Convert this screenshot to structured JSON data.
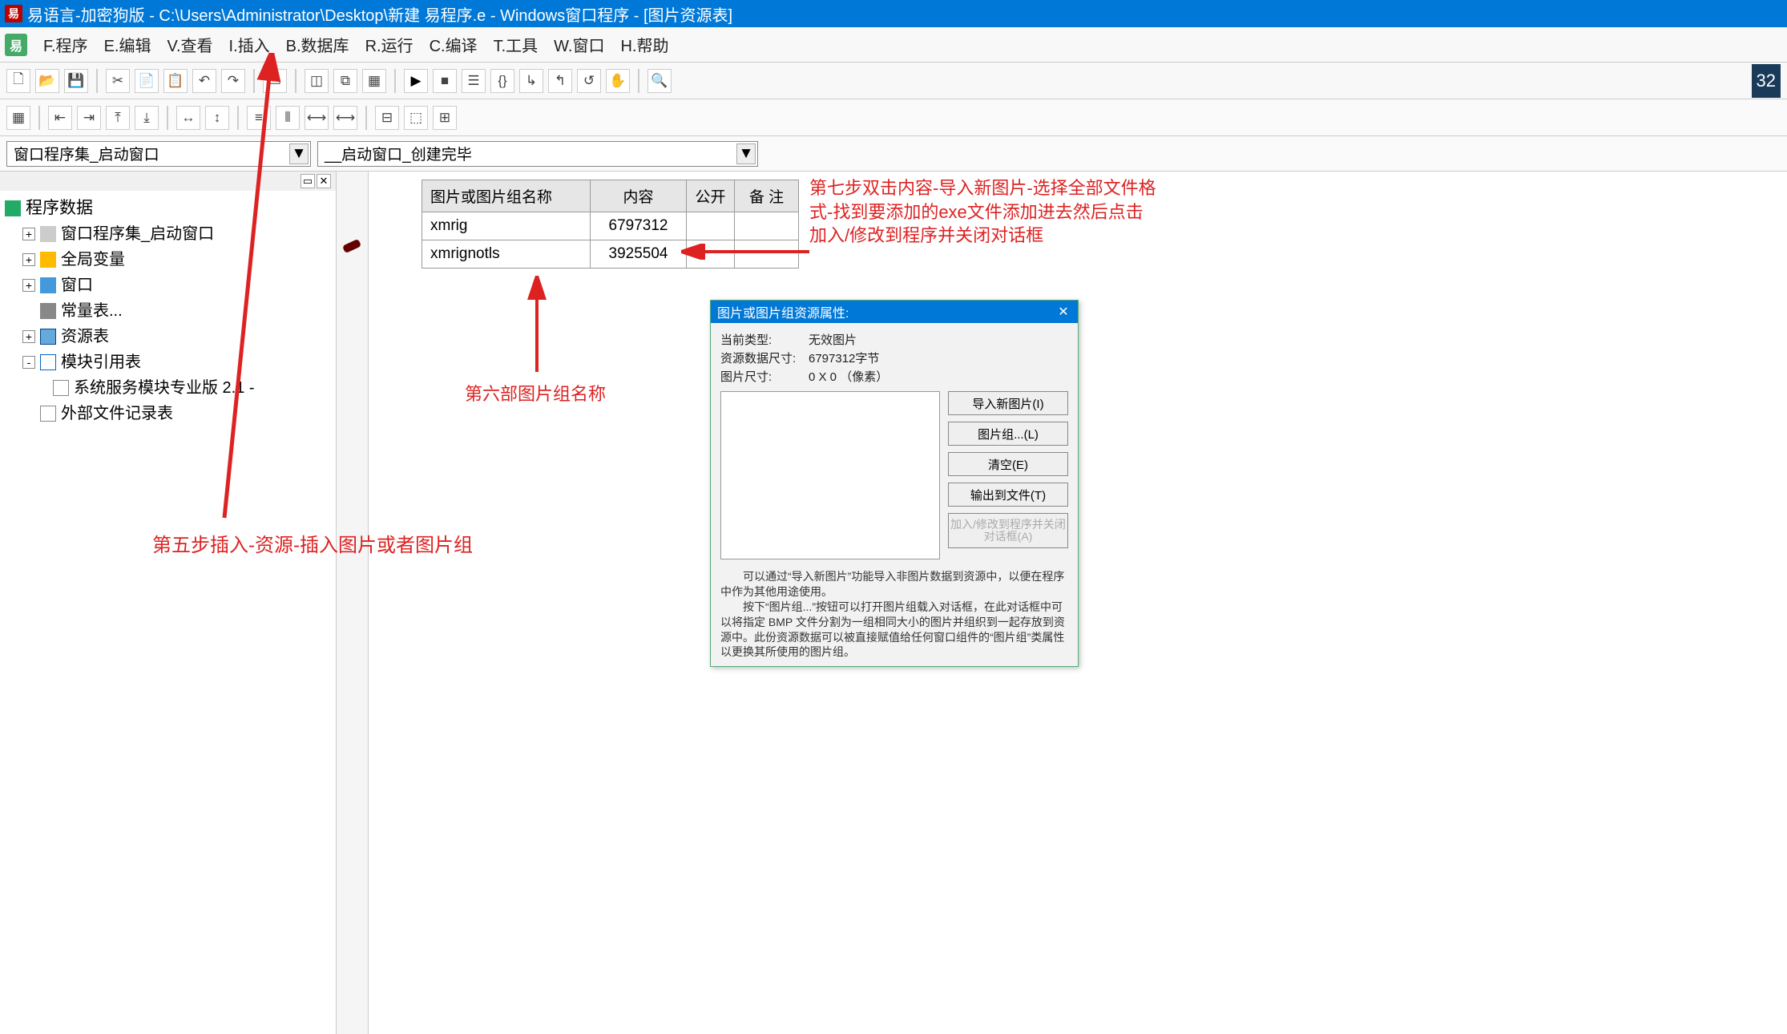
{
  "titlebar": "易语言-加密狗版 - C:\\Users\\Administrator\\Desktop\\新建 易程序.e - Windows窗口程序 - [图片资源表]",
  "menu": {
    "program": "F.程序",
    "edit": "E.编辑",
    "view": "V.查看",
    "insert": "I.插入",
    "database": "B.数据库",
    "run": "R.运行",
    "compile": "C.编译",
    "tools": "T.工具",
    "window": "W.窗口",
    "help": "H.帮助"
  },
  "badge": "32",
  "combo": {
    "left": "窗口程序集_启动窗口",
    "right": "__启动窗口_创建完毕"
  },
  "tree": {
    "title": "程序数据",
    "items": {
      "progset": "窗口程序集_启动窗口",
      "globals": "全局变量",
      "window": "窗口",
      "consts": "常量表...",
      "resources": "资源表",
      "modules": "模块引用表",
      "moduleChild": "系统服务模块专业版 2.1 -",
      "extfiles": "外部文件记录表"
    }
  },
  "table": {
    "h_name": "图片或图片组名称",
    "h_content": "内容",
    "h_public": "公开",
    "h_note": "备 注",
    "rows": [
      {
        "name": "xmrig",
        "content": "6797312"
      },
      {
        "name": "xmrignotls",
        "content": "3925504"
      }
    ]
  },
  "annot": {
    "step5": "第五步插入-资源-插入图片或者图片组",
    "step6": "第六部图片组名称",
    "step7": "第七步双击内容-导入新图片-选择全部文件格式-找到要添加的exe文件添加进去然后点击 加入/修改到程序并关闭对话框"
  },
  "dialog": {
    "title": "图片或图片组资源属性:",
    "info": {
      "l_type": "当前类型:",
      "v_type": "无效图片",
      "l_size": "资源数据尺寸:",
      "v_size": "6797312字节",
      "l_dim": "图片尺寸:",
      "v_dim": "0 X 0 （像素）"
    },
    "buttons": {
      "import": "导入新图片(I)",
      "group": "图片组...(L)",
      "clear": "清空(E)",
      "export": "输出到文件(T)",
      "apply": "加入/修改到程序并关闭对话框(A)"
    },
    "help": "　　可以通过“导入新图片”功能导入非图片数据到资源中，以便在程序中作为其他用途使用。\n　　按下“图片组...”按钮可以打开图片组载入对话框，在此对话框中可以将指定 BMP 文件分割为一组相同大小的图片并组织到一起存放到资源中。此份资源数据可以被直接赋值给任何窗口组件的“图片组”类属性以更换其所使用的图片组。"
  }
}
